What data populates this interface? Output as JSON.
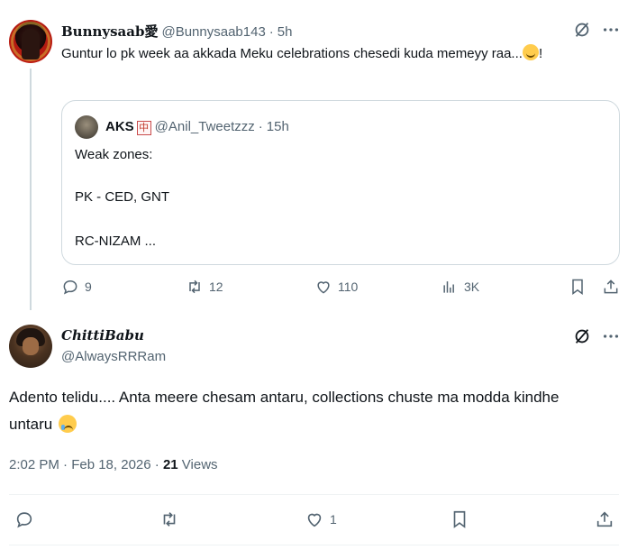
{
  "parent": {
    "name": "Bunnysaab愛",
    "handle": "@Bunnysaab143",
    "time": "5h",
    "text": "Guntur lo pk week aa akkada Meku celebrations chesedi kuda memeyy raa...",
    "text_suffix": "!",
    "quote": {
      "name": "AKS",
      "name_badge": "中",
      "handle": "@Anil_Tweetzzz",
      "time": "15h",
      "lines": [
        "Weak zones:",
        "PK - CED, GNT",
        "RC-NIZAM ..."
      ]
    },
    "actions": {
      "replies": "9",
      "reposts": "12",
      "likes": "110",
      "views": "3K"
    }
  },
  "main": {
    "name": "ChittiBabu",
    "handle": "@AlwaysRRRam",
    "text": "Adento telidu.... Anta meere chesam antaru, collections chuste ma modda kindhe untaru",
    "timestamp": "2:02 PM · Feb 18, 2026 · ",
    "views_count": "21",
    "views_label": " Views",
    "actions": {
      "likes": "1"
    }
  },
  "colors": {
    "muted": "#536471",
    "text": "#0f1419",
    "border": "#cfd9de"
  }
}
